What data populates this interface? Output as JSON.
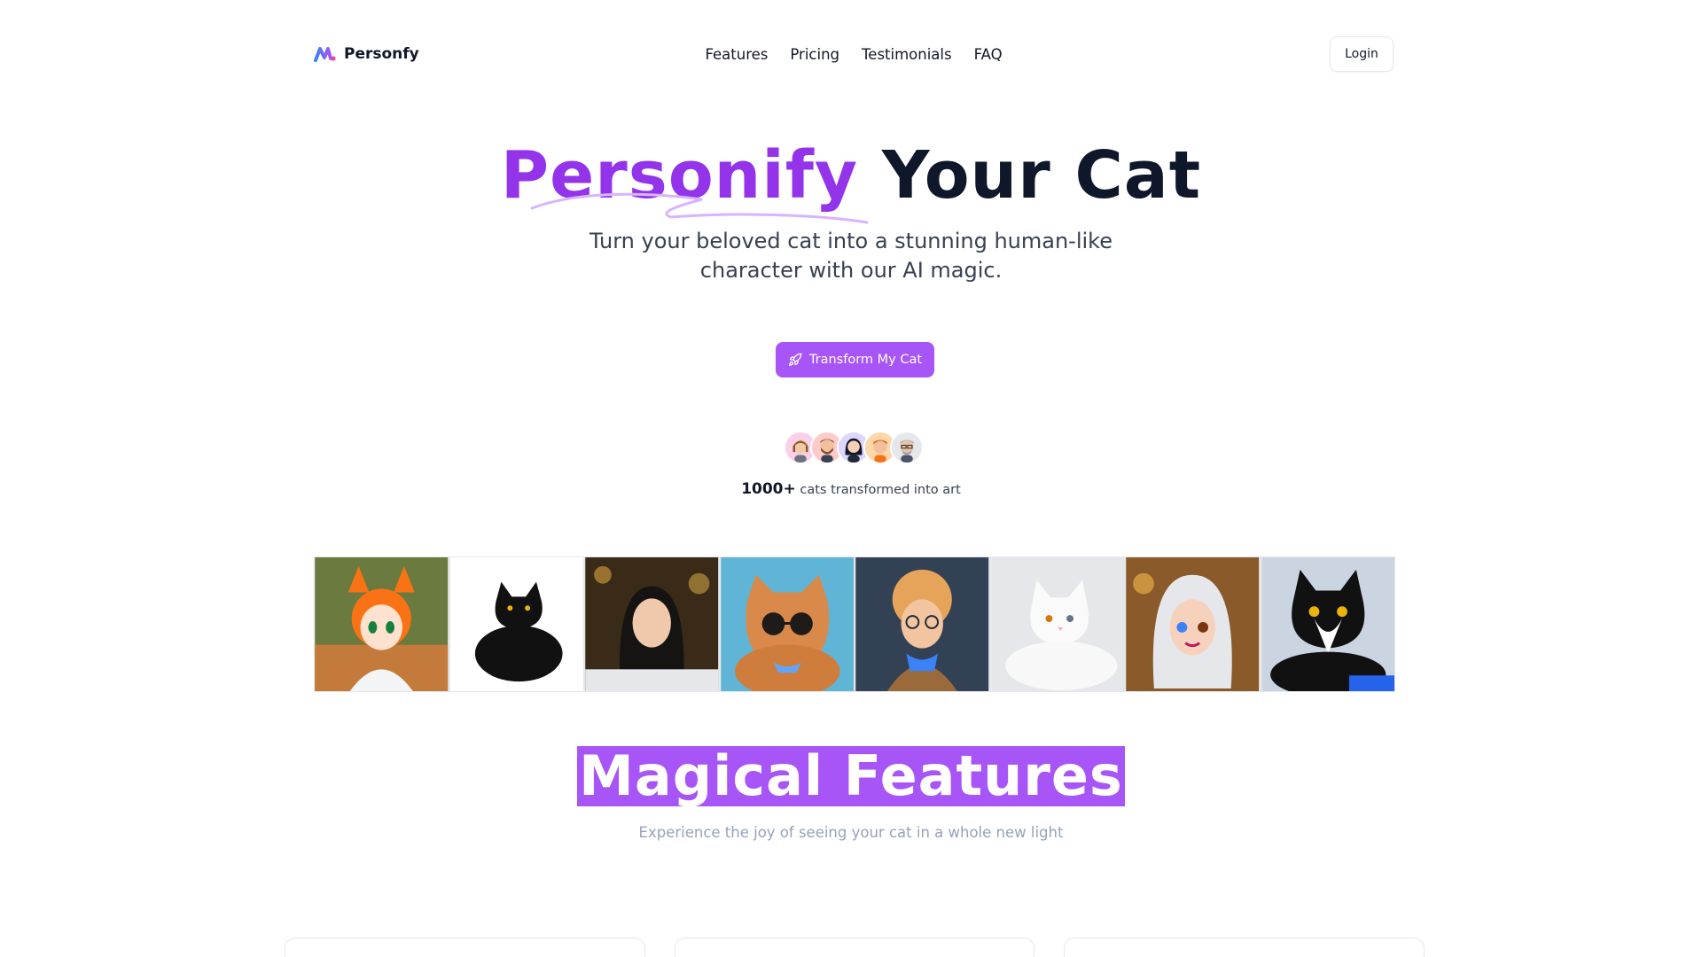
{
  "nav": {
    "brand": "Personfy",
    "links": [
      "Features",
      "Pricing",
      "Testimonials",
      "FAQ"
    ],
    "login_label": "Login"
  },
  "hero": {
    "title_accent": "Personify",
    "title_rest": "Your Cat",
    "subtitle": "Turn your beloved cat into a stunning human-like character with our AI magic.",
    "cta_label": "Transform My Cat",
    "cta_icon": "rocket-icon",
    "social_count": "1000+",
    "social_text": "cats transformed into art"
  },
  "gallery": {
    "items": [
      "anime-cat-girl",
      "black-cat",
      "dark-haired-woman",
      "cat-with-sunglasses",
      "curly-haired-boy",
      "white-cat",
      "white-haired-girl",
      "tuxedo-cat"
    ]
  },
  "features": {
    "title": "Magical Features",
    "subtitle": "Experience the joy of seeing your cat in a whole new light"
  },
  "colors": {
    "accent": "#9333ea",
    "cta": "#a855f7",
    "dark": "#0f172a"
  }
}
